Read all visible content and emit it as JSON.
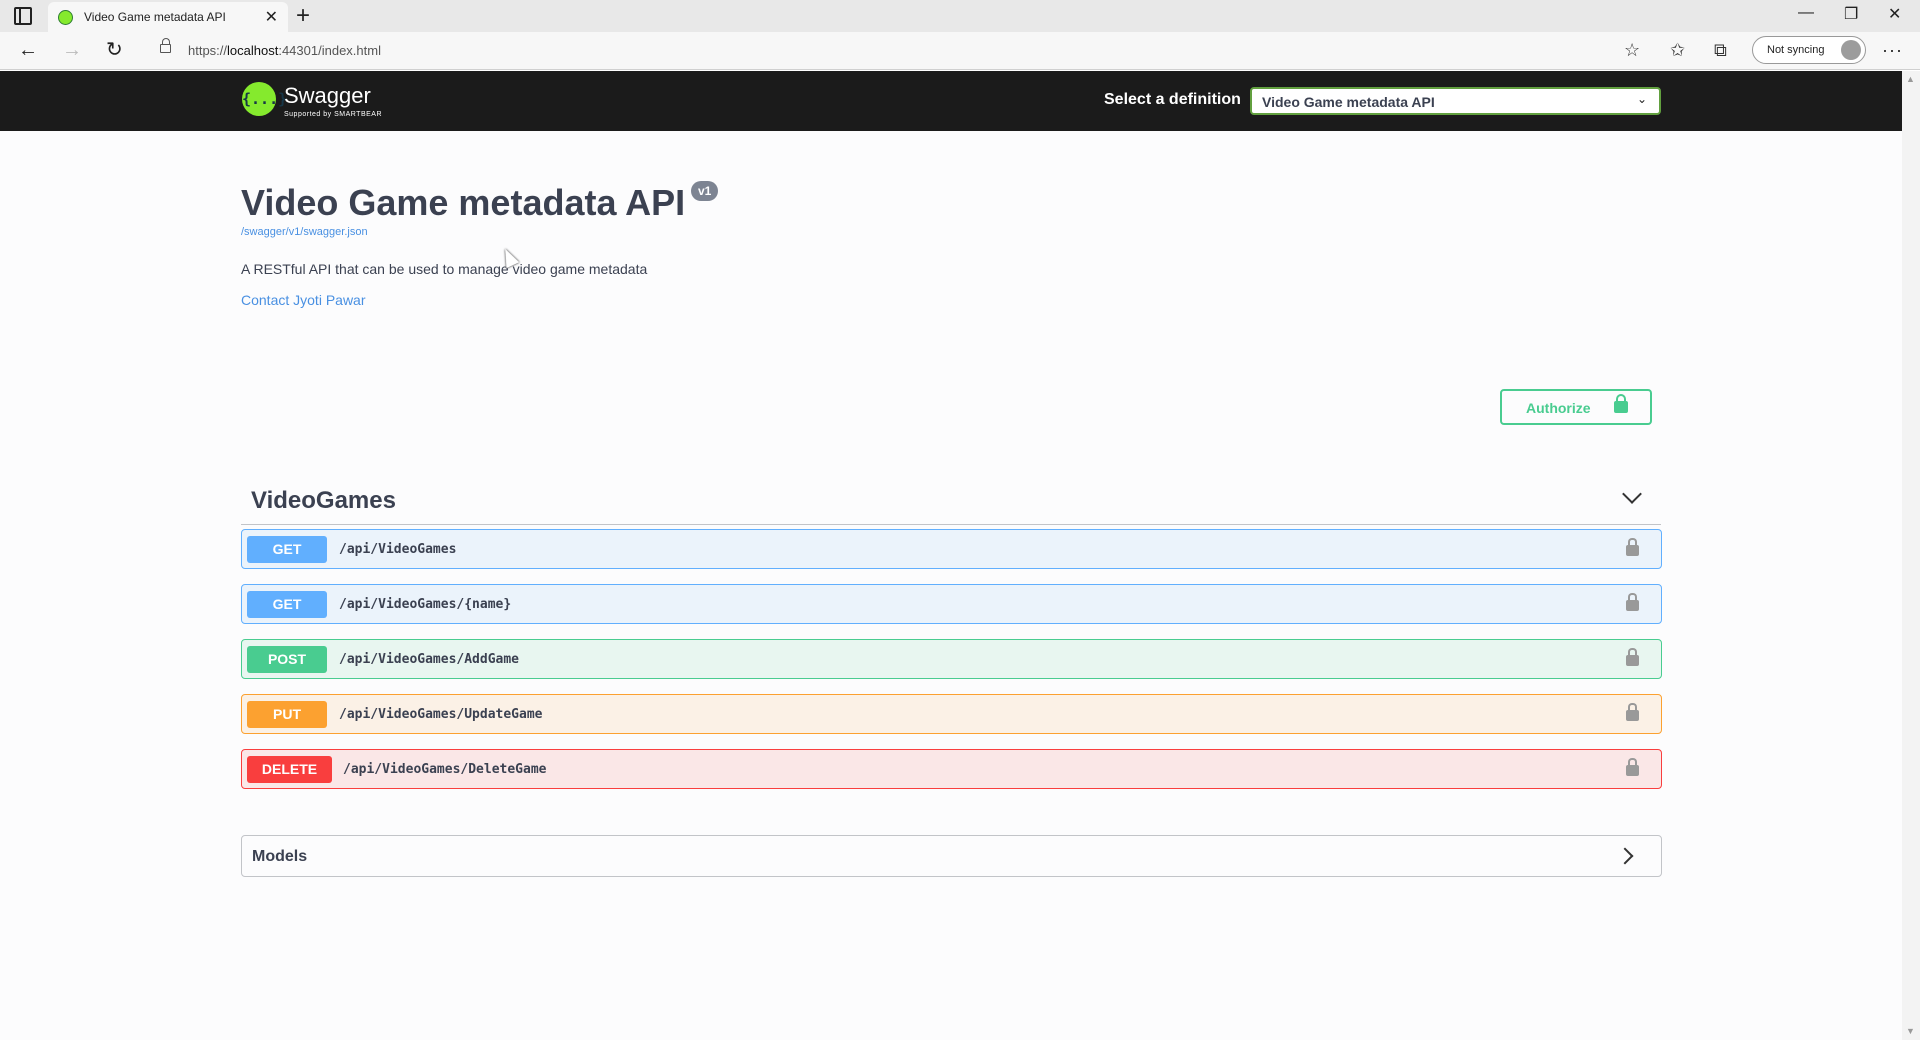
{
  "browser": {
    "tab_title": "Video Game metadata API",
    "url_prefix": "https://",
    "url_host": "localhost",
    "url_rest": ":44301/index.html",
    "sync_label": "Not syncing"
  },
  "topbar": {
    "logo_icon": "{...}",
    "logo_text": "Swagger",
    "logo_sub": "Supported by SMARTBEAR",
    "definition_label": "Select a definition",
    "definition_value": "Video Game metadata API"
  },
  "info": {
    "title": "Video Game metadata API",
    "version": "v1",
    "spec_url": "/swagger/v1/swagger.json",
    "description": "A RESTful API that can be used to manage video game metadata",
    "contact": "Contact Jyoti Pawar"
  },
  "authorize": {
    "label": "Authorize"
  },
  "tag": {
    "name": "VideoGames",
    "operations": [
      {
        "method": "GET",
        "path": "/api/VideoGames"
      },
      {
        "method": "GET",
        "path": "/api/VideoGames/{name}"
      },
      {
        "method": "POST",
        "path": "/api/VideoGames/AddGame"
      },
      {
        "method": "PUT",
        "path": "/api/VideoGames/UpdateGame"
      },
      {
        "method": "DELETE",
        "path": "/api/VideoGames/DeleteGame"
      }
    ]
  },
  "models": {
    "label": "Models"
  },
  "colors": {
    "get": "#61affe",
    "post": "#49cc90",
    "put": "#fca130",
    "delete": "#f93e3e",
    "topbar": "#1b1b1b",
    "swagger_green": "#85ea2d"
  }
}
